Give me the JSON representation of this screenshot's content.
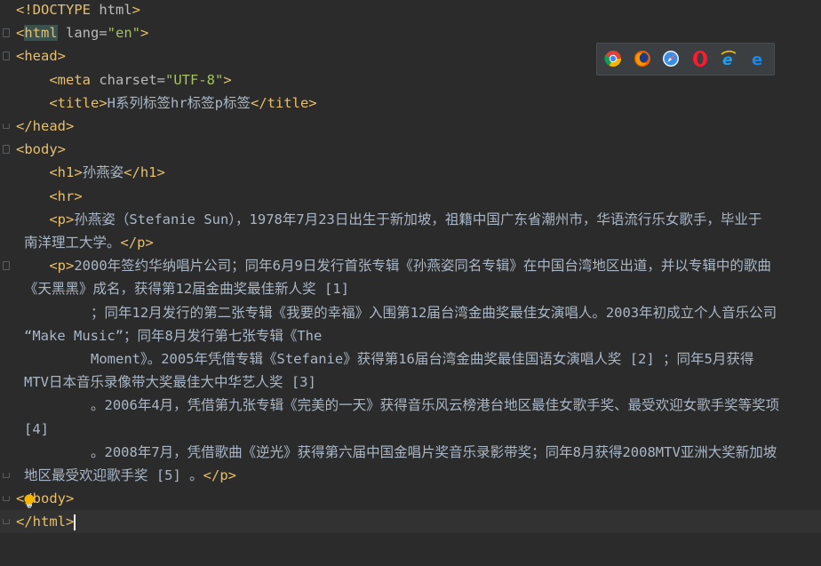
{
  "editor": {
    "lines": [
      {
        "segs": [
          [
            "tag",
            "<!DOCTYPE "
          ],
          [
            "attr",
            "html"
          ],
          [
            "tag",
            ">"
          ]
        ]
      },
      {
        "segs": [
          [
            "tag",
            "<"
          ],
          [
            "tagh",
            "html"
          ],
          [
            "attr",
            " lang="
          ],
          [
            "val",
            "\"en\""
          ],
          [
            "tag",
            ">"
          ]
        ]
      },
      {
        "segs": [
          [
            "tag",
            "<head>"
          ]
        ]
      },
      {
        "segs": [
          [
            "txt",
            "    "
          ],
          [
            "tag",
            "<meta "
          ],
          [
            "attr",
            "charset="
          ],
          [
            "val",
            "\"UTF-8\""
          ],
          [
            "tag",
            ">"
          ]
        ]
      },
      {
        "segs": [
          [
            "txt",
            "    "
          ],
          [
            "tag",
            "<title>"
          ],
          [
            "txt",
            "H系列标签hr标签p标签"
          ],
          [
            "tag",
            "</title>"
          ]
        ]
      },
      {
        "segs": [
          [
            "tag",
            "</head>"
          ]
        ]
      },
      {
        "segs": [
          [
            "tag",
            "<body>"
          ]
        ]
      },
      {
        "segs": [
          [
            "txt",
            "    "
          ],
          [
            "tag",
            "<h1>"
          ],
          [
            "txt",
            "孙燕姿"
          ],
          [
            "tag",
            "</h1>"
          ]
        ]
      },
      {
        "segs": [
          [
            "txt",
            "    "
          ],
          [
            "tag",
            "<hr>"
          ]
        ]
      },
      {
        "segs": [
          [
            "txt",
            "    "
          ],
          [
            "tag",
            "<p>"
          ],
          [
            "txt",
            "孙燕姿（Stefanie Sun），1978年7月23日出生于新加坡，祖籍中国广东省潮州市，华语流行乐女歌手，毕业于"
          ]
        ]
      },
      {
        "wrap": true,
        "segs": [
          [
            "txt",
            "南洋理工大学。"
          ],
          [
            "tag",
            "</p>"
          ]
        ]
      },
      {
        "segs": [
          [
            "txt",
            "    "
          ],
          [
            "tag",
            "<p>"
          ],
          [
            "txt",
            "2000年签约华纳唱片公司；同年6月9日发行首张专辑《孙燕姿同名专辑》在中国台湾地区出道，并以专辑中的歌曲"
          ]
        ]
      },
      {
        "wrap": true,
        "segs": [
          [
            "txt",
            "《天黑黑》成名，获得第12届金曲奖最佳新人奖 [1]"
          ]
        ]
      },
      {
        "segs": [
          [
            "txt",
            "         ；同年12月发行的第二张专辑《我要的幸福》入围第12届台湾金曲奖最佳女演唱人。2003年初成立个人音乐公司"
          ]
        ]
      },
      {
        "wrap": true,
        "segs": [
          [
            "txt",
            "“Make Music”；同年8月发行第七张专辑《The"
          ]
        ]
      },
      {
        "segs": [
          [
            "txt",
            "         Moment》。2005年凭借专辑《Stefanie》获得第16届台湾金曲奖最佳国语女演唱人奖 [2] ；同年5月获得"
          ]
        ]
      },
      {
        "wrap": true,
        "segs": [
          [
            "txt",
            "MTV日本音乐录像带大奖最佳大中华艺人奖 [3]"
          ]
        ]
      },
      {
        "segs": [
          [
            "txt",
            "         。2006年4月，凭借第九张专辑《完美的一天》获得音乐风云榜港台地区最佳女歌手奖、最受欢迎女歌手奖等奖项"
          ]
        ]
      },
      {
        "wrap": true,
        "segs": [
          [
            "txt",
            "[4]"
          ]
        ]
      },
      {
        "segs": [
          [
            "txt",
            "         。2008年7月，凭借歌曲《逆光》获得第六届中国金唱片奖音乐录影带奖；同年8月获得2008MTV亚洲大奖新加坡"
          ]
        ]
      },
      {
        "wrap": true,
        "segs": [
          [
            "txt",
            "地区最受欢迎歌手奖 [5] 。"
          ],
          [
            "tag",
            "</p>"
          ]
        ]
      },
      {
        "segs": [
          [
            "tag",
            "</body>"
          ]
        ]
      },
      {
        "segs": [
          [
            "tag",
            "</html>"
          ]
        ]
      }
    ]
  },
  "browsers": [
    "chrome-icon",
    "firefox-icon",
    "safari-icon",
    "opera-icon",
    "ie-icon",
    "edge-icon"
  ],
  "colors": {
    "tag": "#e8bf6a",
    "attr": "#bababa",
    "value": "#a5c25c",
    "text": "#a9b7c6",
    "background": "#2b2b2b"
  }
}
